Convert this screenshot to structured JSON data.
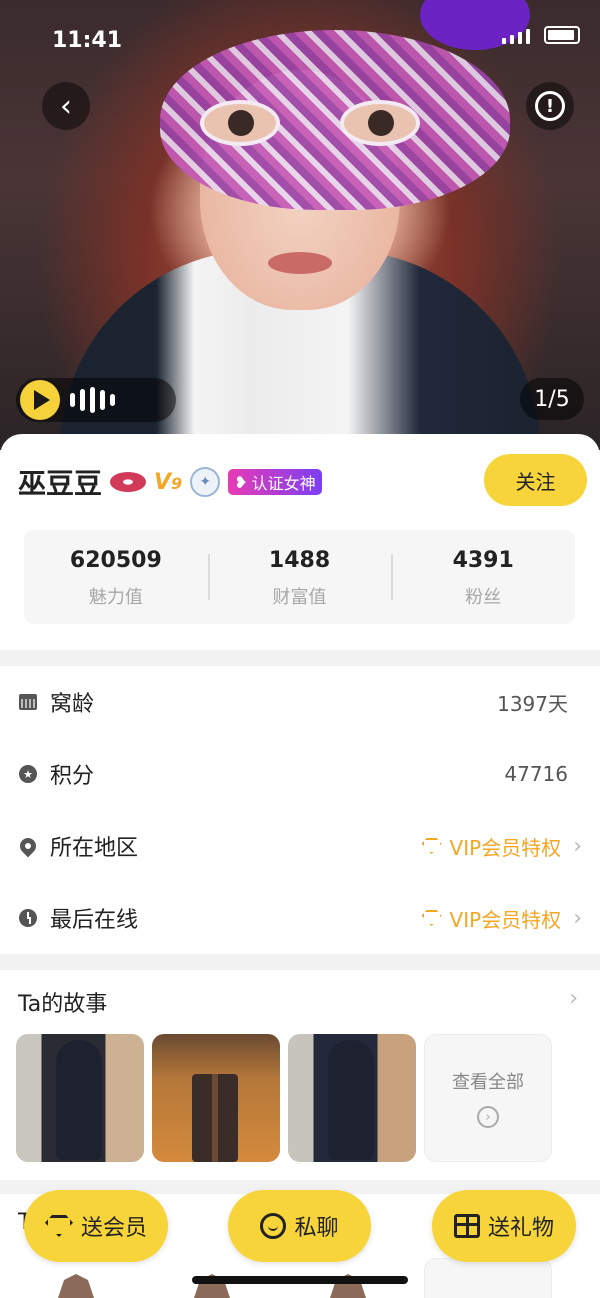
{
  "status_bar": {
    "time": "11:41"
  },
  "photo": {
    "counter": "1/5"
  },
  "profile": {
    "name": "巫豆豆",
    "vip_level": "9",
    "verify_badge": "认证女神",
    "follow_label": "关注",
    "stats": [
      {
        "value": "620509",
        "label": "魅力值"
      },
      {
        "value": "1488",
        "label": "财富值"
      },
      {
        "value": "4391",
        "label": "粉丝"
      }
    ]
  },
  "info": {
    "rows": [
      {
        "label": "窝龄",
        "value": "1397天"
      },
      {
        "label": "积分",
        "value": "47716"
      },
      {
        "label": "所在地区",
        "value": "VIP会员特权"
      },
      {
        "label": "最后在线",
        "value": "VIP会员特权"
      }
    ]
  },
  "stories": {
    "title": "Ta的故事",
    "see_all": "查看全部"
  },
  "gifts": {
    "title": "T"
  },
  "actions": {
    "send_vip": "送会员",
    "chat": "私聊",
    "send_gift": "送礼物"
  },
  "colors": {
    "accent": "#f7d43a",
    "vip_orange": "#f5a623",
    "verify_gradient_start": "#e83bb3",
    "verify_gradient_end": "#7b3ff2"
  }
}
